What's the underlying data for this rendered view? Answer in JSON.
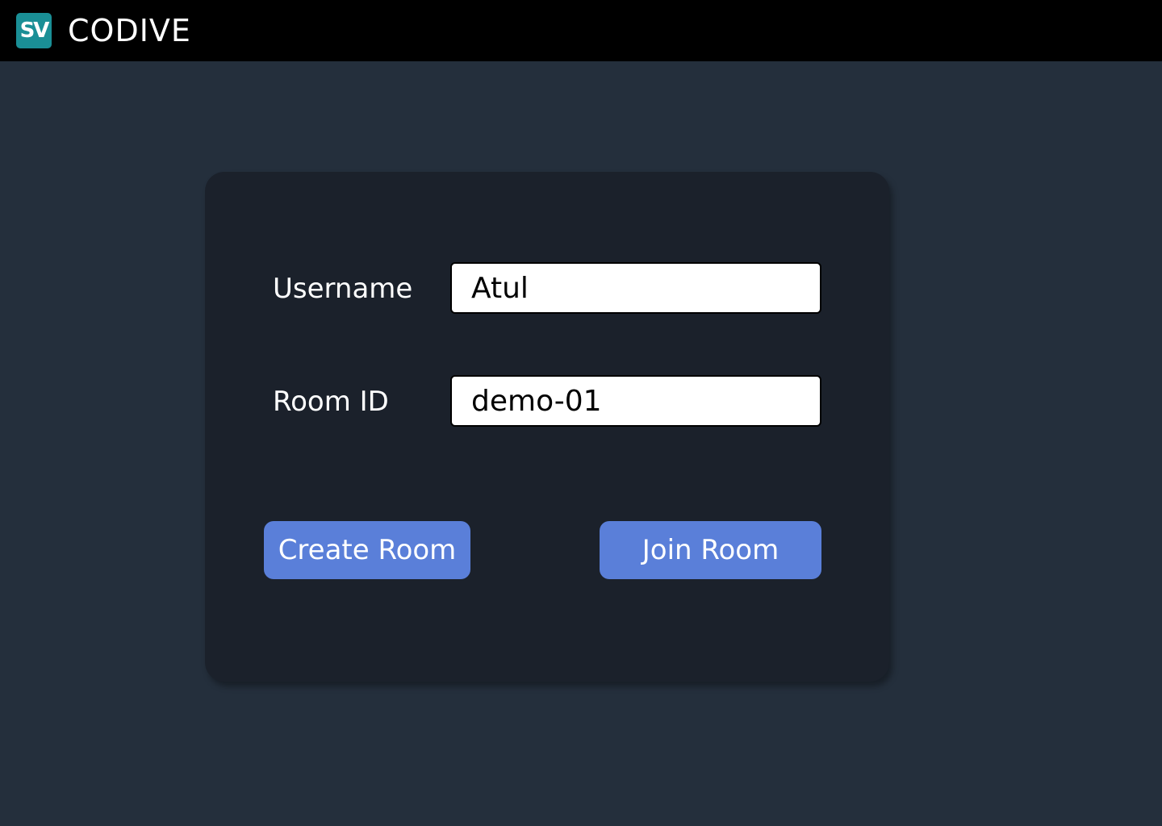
{
  "header": {
    "logo_text": "SV",
    "brand": "CODIVE"
  },
  "form": {
    "username_label": "Username",
    "username_value": "Atul",
    "room_id_label": "Room ID",
    "room_id_value": "demo-01",
    "create_button": "Create Room",
    "join_button": "Join Room"
  },
  "colors": {
    "background": "#242f3c",
    "topbar": "#000000",
    "card": "#1b212b",
    "logo": "#1a8f96",
    "button": "#5a7fd9"
  }
}
